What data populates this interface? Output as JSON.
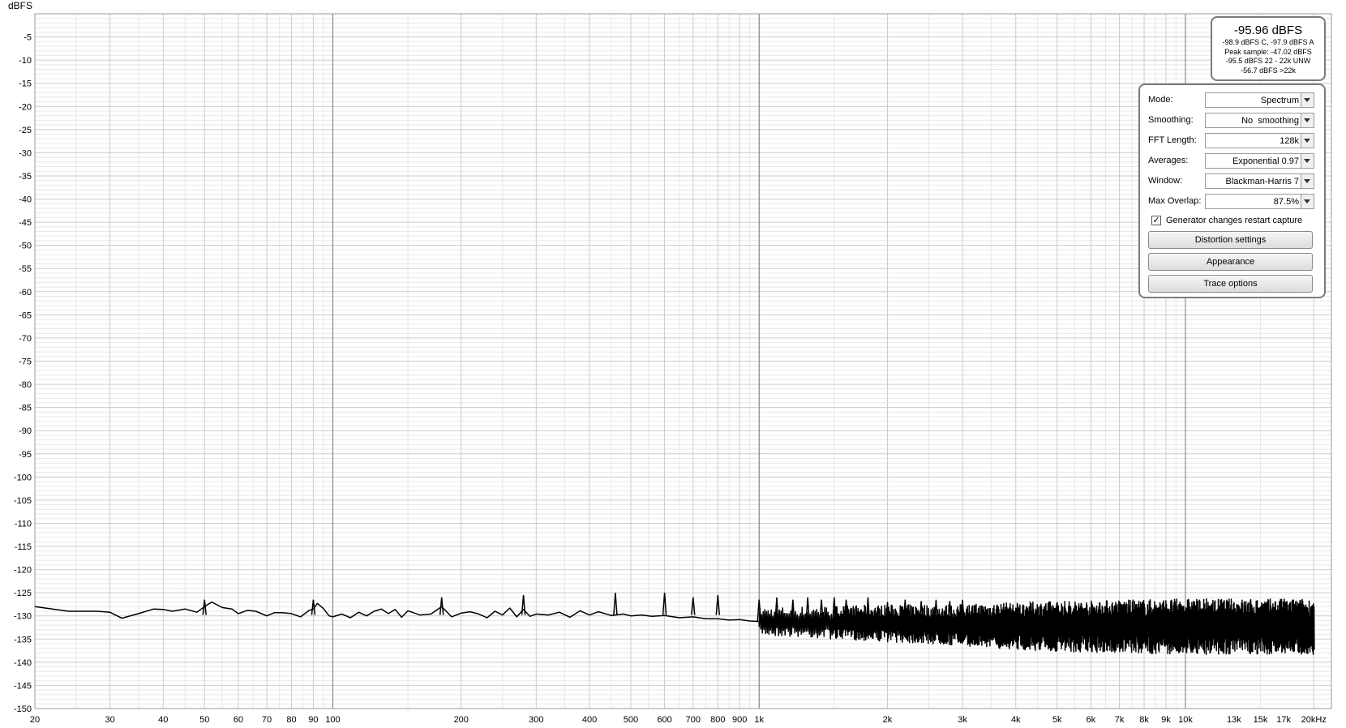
{
  "chart_data": {
    "type": "line",
    "ylabel": "dBFS",
    "xscale": "log",
    "xlim": [
      20,
      22000
    ],
    "ylim": [
      -150,
      0
    ],
    "y_ticks": [
      -5,
      -10,
      -15,
      -20,
      -25,
      -30,
      -35,
      -40,
      -45,
      -50,
      -55,
      -60,
      -65,
      -70,
      -75,
      -80,
      -85,
      -90,
      -95,
      -100,
      -105,
      -110,
      -115,
      -120,
      -125,
      -130,
      -135,
      -140,
      -145,
      -150
    ],
    "y_tick_labels": [
      "-5",
      "-10",
      "-15",
      "-20",
      "-25",
      "-30",
      "-35",
      "-40",
      "-45",
      "-50",
      "-55",
      "-60",
      "-65",
      "-70",
      "-75",
      "-80",
      "-85",
      "-90",
      "-95",
      "-100",
      "-105",
      "-110",
      "-115",
      "-120",
      "-125",
      "-130",
      "-135",
      "-140",
      "-145",
      "-150"
    ],
    "x_ticks": [
      20,
      30,
      40,
      50,
      60,
      70,
      80,
      90,
      100,
      200,
      300,
      400,
      500,
      600,
      700,
      800,
      900,
      1000,
      2000,
      3000,
      4000,
      5000,
      6000,
      7000,
      8000,
      9000,
      10000,
      13000,
      15000,
      17000,
      20000
    ],
    "x_tick_labels": [
      "20",
      "30",
      "40",
      "50",
      "60",
      "70",
      "80",
      "90",
      "100",
      "200",
      "300",
      "400",
      "500",
      "600",
      "700",
      "800",
      "900",
      "1k",
      "2k",
      "3k",
      "4k",
      "5k",
      "6k",
      "7k",
      "8k",
      "9k",
      "10k",
      "13k",
      "15k",
      "17k",
      "20kHz"
    ],
    "x_tick_dim": [
      false,
      false,
      false,
      false,
      false,
      false,
      false,
      false,
      false,
      false,
      false,
      false,
      false,
      false,
      false,
      false,
      false,
      false,
      false,
      false,
      false,
      false,
      false,
      false,
      false,
      false,
      false,
      true,
      true,
      true,
      false
    ],
    "decade_lines": [
      100,
      1000,
      10000
    ],
    "grid": true,
    "series": [
      {
        "x": [
          20,
          24,
          28,
          30,
          32,
          35,
          38,
          40,
          42,
          45,
          48,
          50,
          52,
          55,
          58,
          60,
          63,
          66,
          70,
          73,
          76,
          80,
          84,
          88,
          90,
          92,
          95,
          98,
          100,
          105,
          110,
          115,
          120,
          125,
          130,
          135,
          140,
          145,
          150,
          160,
          170,
          180,
          190,
          200,
          210,
          220,
          230,
          240,
          250,
          260,
          270,
          280,
          290,
          300,
          320,
          340,
          360,
          380,
          400,
          420,
          450,
          480,
          500,
          530,
          560,
          600,
          650,
          700,
          750,
          800,
          850,
          900,
          950,
          1000
        ],
        "y": [
          -128,
          -129,
          -129,
          -129.2,
          -130.5,
          -129.5,
          -128.5,
          -128.6,
          -129,
          -128.5,
          -129.2,
          -128,
          -127,
          -128.2,
          -128.5,
          -129.5,
          -128.8,
          -129,
          -130,
          -129.3,
          -129.3,
          -129.5,
          -130.2,
          -128.8,
          -128.5,
          -127.3,
          -128.4,
          -130,
          -130.2,
          -129.6,
          -130.4,
          -129.2,
          -130,
          -129,
          -128.5,
          -129.5,
          -128.6,
          -130.3,
          -128.9,
          -129.8,
          -129.6,
          -128,
          -130.2,
          -129.4,
          -129.1,
          -129.6,
          -130.4,
          -129,
          -129.8,
          -128.3,
          -130.2,
          -128.6,
          -130.1,
          -129.6,
          -129.8,
          -129.2,
          -130.3,
          -128.9,
          -129.8,
          -129.1,
          -129.9,
          -129.6,
          -130,
          -129.8,
          -130.1,
          -129.9,
          -130.4,
          -130.2,
          -130.6,
          -130.6,
          -130.9,
          -130.8,
          -131.1,
          -131.2
        ],
        "noise_floor": {
          "x": [
            1000,
            2000,
            3000,
            5000,
            10000,
            20000
          ],
          "center": [
            -131.2,
            -131.6,
            -132,
            -132.3,
            -132.3,
            -132.3
          ],
          "spread": [
            3,
            4,
            4.5,
            5.5,
            6,
            6
          ]
        }
      }
    ],
    "peaks": {
      "x": [
        50,
        90,
        180,
        280,
        460,
        600,
        700,
        800,
        1000,
        1100,
        1200,
        1300,
        1400,
        1500,
        1600,
        1800,
        2000,
        2200,
        2400,
        2600,
        2800,
        3000
      ],
      "y": [
        -126.5,
        -126.5,
        -126,
        -125.5,
        -125,
        -125,
        -126,
        -125.5,
        -126.5,
        -126,
        -126.5,
        -126,
        -126.5,
        -126,
        -126.5,
        -126,
        -127,
        -126.5,
        -126.8,
        -126.5,
        -126.8,
        -126.5
      ]
    }
  },
  "level_readout": {
    "main": "-95.96 dBFS",
    "weighted": "-98.9 dBFS C, -97.9 dBFS A",
    "peak": "Peak sample: -47.02 dBFS",
    "band": "-95.5 dBFS 22 - 22k UNW",
    "above": "-56.7 dBFS >22k"
  },
  "settings": {
    "mode": {
      "label": "Mode:",
      "value": "Spectrum"
    },
    "smoothing": {
      "label": "Smoothing:",
      "value": "No  smoothing"
    },
    "fft_length": {
      "label": "FFT Length:",
      "value": "128k"
    },
    "averages": {
      "label": "Averages:",
      "value": "Exponential 0.97"
    },
    "window": {
      "label": "Window:",
      "value": "Blackman-Harris 7"
    },
    "max_overlap": {
      "label": "Max Overlap:",
      "value": "87.5%"
    },
    "generator_checkbox": {
      "label": "Generator changes restart capture",
      "checked": true,
      "mark": "✓"
    },
    "distortion_button": "Distortion settings",
    "appearance_button": "Appearance",
    "trace_button": "Trace options"
  },
  "colors": {
    "trace": "#000000",
    "grid_major": "#cccccc",
    "grid_minor": "#e8e8e8",
    "decade_line": "#777777",
    "axis_text": "#000000",
    "dim_text": "#9a9a9a"
  }
}
